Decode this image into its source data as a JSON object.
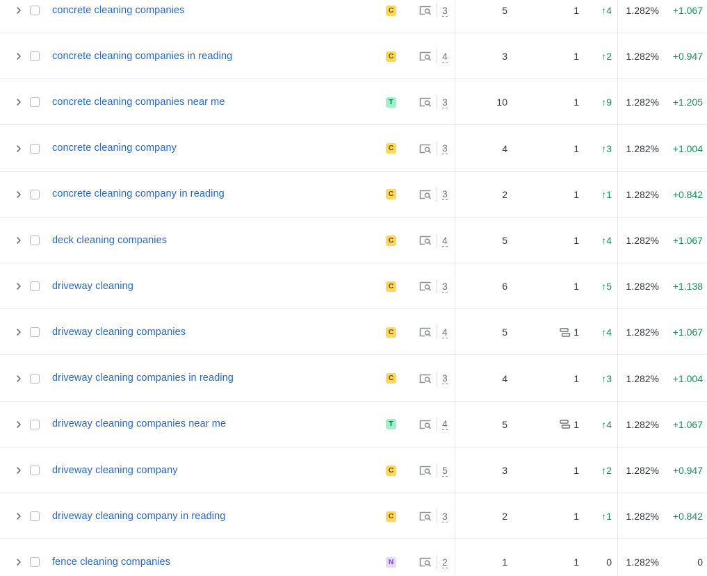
{
  "table": {
    "rows": [
      {
        "keyword": "concrete cleaning companies",
        "intent": "C",
        "serp_features": "3",
        "kd": "5",
        "position": "1",
        "position_icon": false,
        "diff": "↑4",
        "visibility": "1.282%",
        "visibility_change": "+1.067"
      },
      {
        "keyword": "concrete cleaning companies in reading",
        "intent": "C",
        "serp_features": "4",
        "kd": "3",
        "position": "1",
        "position_icon": false,
        "diff": "↑2",
        "visibility": "1.282%",
        "visibility_change": "+0.947"
      },
      {
        "keyword": "concrete cleaning companies near me",
        "intent": "T",
        "serp_features": "3",
        "kd": "10",
        "position": "1",
        "position_icon": false,
        "diff": "↑9",
        "visibility": "1.282%",
        "visibility_change": "+1.205"
      },
      {
        "keyword": "concrete cleaning company",
        "intent": "C",
        "serp_features": "3",
        "kd": "4",
        "position": "1",
        "position_icon": false,
        "diff": "↑3",
        "visibility": "1.282%",
        "visibility_change": "+1.004"
      },
      {
        "keyword": "concrete cleaning company in reading",
        "intent": "C",
        "serp_features": "3",
        "kd": "2",
        "position": "1",
        "position_icon": false,
        "diff": "↑1",
        "visibility": "1.282%",
        "visibility_change": "+0.842"
      },
      {
        "keyword": "deck cleaning companies",
        "intent": "C",
        "serp_features": "4",
        "kd": "5",
        "position": "1",
        "position_icon": false,
        "diff": "↑4",
        "visibility": "1.282%",
        "visibility_change": "+1.067"
      },
      {
        "keyword": "driveway cleaning",
        "intent": "C",
        "serp_features": "3",
        "kd": "6",
        "position": "1",
        "position_icon": false,
        "diff": "↑5",
        "visibility": "1.282%",
        "visibility_change": "+1.138"
      },
      {
        "keyword": "driveway cleaning companies",
        "intent": "C",
        "serp_features": "4",
        "kd": "5",
        "position": "1",
        "position_icon": true,
        "diff": "↑4",
        "visibility": "1.282%",
        "visibility_change": "+1.067"
      },
      {
        "keyword": "driveway cleaning companies in reading",
        "intent": "C",
        "serp_features": "3",
        "kd": "4",
        "position": "1",
        "position_icon": false,
        "diff": "↑3",
        "visibility": "1.282%",
        "visibility_change": "+1.004"
      },
      {
        "keyword": "driveway cleaning companies near me",
        "intent": "T",
        "serp_features": "4",
        "kd": "5",
        "position": "1",
        "position_icon": true,
        "diff": "↑4",
        "visibility": "1.282%",
        "visibility_change": "+1.067"
      },
      {
        "keyword": "driveway cleaning company",
        "intent": "C",
        "serp_features": "5",
        "kd": "3",
        "position": "1",
        "position_icon": false,
        "diff": "↑2",
        "visibility": "1.282%",
        "visibility_change": "+0.947"
      },
      {
        "keyword": "driveway cleaning company in reading",
        "intent": "C",
        "serp_features": "3",
        "kd": "2",
        "position": "1",
        "position_icon": false,
        "diff": "↑1",
        "visibility": "1.282%",
        "visibility_change": "+0.842"
      },
      {
        "keyword": "fence cleaning companies",
        "intent": "N",
        "serp_features": "2",
        "kd": "1",
        "position": "1",
        "position_icon": false,
        "diff": "0",
        "visibility": "1.282%",
        "visibility_change": "0"
      }
    ]
  },
  "colors": {
    "link": "#2868c0",
    "intent_commercial": "#fdd85d",
    "intent_transactional": "#9ef2c9",
    "intent_navigational": "#e6d8ff",
    "positive": "#1a8c5a"
  },
  "icons": {
    "expand": "chevron-right-icon",
    "serp": "serp-features-icon",
    "position": "position-stack-icon"
  }
}
